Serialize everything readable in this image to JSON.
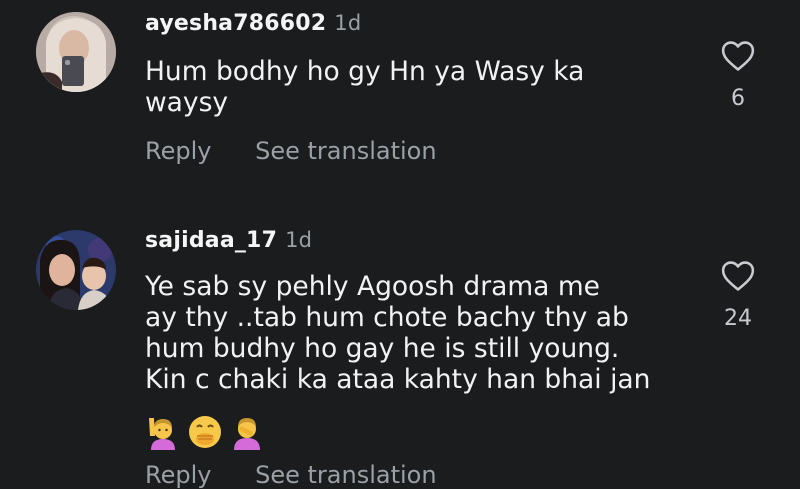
{
  "comments": [
    {
      "username": "ayesha786602",
      "time": "1d",
      "text_lines": [
        "Hum bodhy ho gy Hn ya Wasy ka",
        "waysy"
      ],
      "likes": "6",
      "reply_label": "Reply",
      "translate_label": "See translation"
    },
    {
      "username": "sajidaa_17",
      "time": "1d",
      "text_lines": [
        "Ye sab sy pehly Agoosh drama me",
        "ay thy ..tab hum chote bachy thy ab",
        "hum budhy ho gay he is still young.",
        "Kin c chaki ka ataa kahty han bhai jan"
      ],
      "emojis": [
        "person-raising-hand-emoji",
        "face-with-hand-over-mouth-emoji",
        "person-facepalming-emoji"
      ],
      "likes": "24",
      "reply_label": "Reply",
      "translate_label": "See translation"
    }
  ],
  "colors": {
    "background": "#1a1c1e",
    "text": "#f2f2f2",
    "secondary": "#9aa0a6"
  }
}
